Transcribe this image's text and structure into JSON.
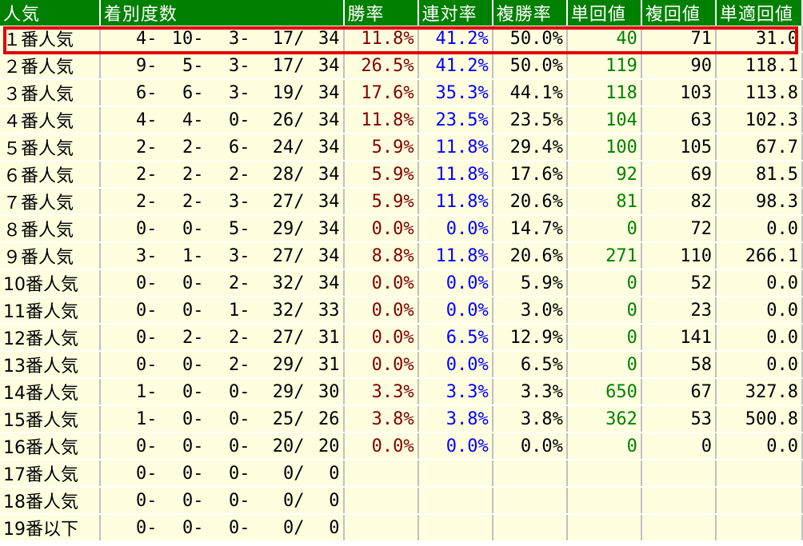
{
  "headers": [
    "人気",
    "着別度数",
    "勝率",
    "連対率",
    "複勝率",
    "単回値",
    "複回値",
    "単適回値"
  ],
  "colors": {
    "header_bg": "#008000",
    "row_bg": "#ffffe0",
    "win": "#800000",
    "ren": "#0000ff",
    "tan": "#008000",
    "highlight": "#e00000"
  },
  "rows": [
    {
      "label": "１番人気",
      "record": [
        "4-",
        "10-",
        "3-",
        "17/",
        "34"
      ],
      "win": "11.8%",
      "ren": "41.2%",
      "fuku": "50.0%",
      "tan": "40",
      "fukuv": "71",
      "tanv": "31.0"
    },
    {
      "label": "２番人気",
      "record": [
        "9-",
        "5-",
        "3-",
        "17/",
        "34"
      ],
      "win": "26.5%",
      "ren": "41.2%",
      "fuku": "50.0%",
      "tan": "119",
      "fukuv": "90",
      "tanv": "118.1"
    },
    {
      "label": "３番人気",
      "record": [
        "6-",
        "6-",
        "3-",
        "19/",
        "34"
      ],
      "win": "17.6%",
      "ren": "35.3%",
      "fuku": "44.1%",
      "tan": "118",
      "fukuv": "103",
      "tanv": "113.8"
    },
    {
      "label": "４番人気",
      "record": [
        "4-",
        "4-",
        "0-",
        "26/",
        "34"
      ],
      "win": "11.8%",
      "ren": "23.5%",
      "fuku": "23.5%",
      "tan": "104",
      "fukuv": "63",
      "tanv": "102.3"
    },
    {
      "label": "５番人気",
      "record": [
        "2-",
        "2-",
        "6-",
        "24/",
        "34"
      ],
      "win": "5.9%",
      "ren": "11.8%",
      "fuku": "29.4%",
      "tan": "100",
      "fukuv": "105",
      "tanv": "67.7"
    },
    {
      "label": "６番人気",
      "record": [
        "2-",
        "2-",
        "2-",
        "28/",
        "34"
      ],
      "win": "5.9%",
      "ren": "11.8%",
      "fuku": "17.6%",
      "tan": "92",
      "fukuv": "69",
      "tanv": "81.5"
    },
    {
      "label": "７番人気",
      "record": [
        "2-",
        "2-",
        "3-",
        "27/",
        "34"
      ],
      "win": "5.9%",
      "ren": "11.8%",
      "fuku": "20.6%",
      "tan": "81",
      "fukuv": "82",
      "tanv": "98.3"
    },
    {
      "label": "８番人気",
      "record": [
        "0-",
        "0-",
        "5-",
        "29/",
        "34"
      ],
      "win": "0.0%",
      "ren": "0.0%",
      "fuku": "14.7%",
      "tan": "0",
      "fukuv": "72",
      "tanv": "0.0"
    },
    {
      "label": "９番人気",
      "record": [
        "3-",
        "1-",
        "3-",
        "27/",
        "34"
      ],
      "win": "8.8%",
      "ren": "11.8%",
      "fuku": "20.6%",
      "tan": "271",
      "fukuv": "110",
      "tanv": "266.1"
    },
    {
      "label": "10番人気",
      "record": [
        "0-",
        "0-",
        "2-",
        "32/",
        "34"
      ],
      "win": "0.0%",
      "ren": "0.0%",
      "fuku": "5.9%",
      "tan": "0",
      "fukuv": "52",
      "tanv": "0.0"
    },
    {
      "label": "11番人気",
      "record": [
        "0-",
        "0-",
        "1-",
        "32/",
        "33"
      ],
      "win": "0.0%",
      "ren": "0.0%",
      "fuku": "3.0%",
      "tan": "0",
      "fukuv": "23",
      "tanv": "0.0"
    },
    {
      "label": "12番人気",
      "record": [
        "0-",
        "2-",
        "2-",
        "27/",
        "31"
      ],
      "win": "0.0%",
      "ren": "6.5%",
      "fuku": "12.9%",
      "tan": "0",
      "fukuv": "141",
      "tanv": "0.0"
    },
    {
      "label": "13番人気",
      "record": [
        "0-",
        "0-",
        "2-",
        "29/",
        "31"
      ],
      "win": "0.0%",
      "ren": "0.0%",
      "fuku": "6.5%",
      "tan": "0",
      "fukuv": "58",
      "tanv": "0.0"
    },
    {
      "label": "14番人気",
      "record": [
        "1-",
        "0-",
        "0-",
        "29/",
        "30"
      ],
      "win": "3.3%",
      "ren": "3.3%",
      "fuku": "3.3%",
      "tan": "650",
      "fukuv": "67",
      "tanv": "327.8"
    },
    {
      "label": "15番人気",
      "record": [
        "1-",
        "0-",
        "0-",
        "25/",
        "26"
      ],
      "win": "3.8%",
      "ren": "3.8%",
      "fuku": "3.8%",
      "tan": "362",
      "fukuv": "53",
      "tanv": "500.8"
    },
    {
      "label": "16番人気",
      "record": [
        "0-",
        "0-",
        "0-",
        "20/",
        "20"
      ],
      "win": "0.0%",
      "ren": "0.0%",
      "fuku": "0.0%",
      "tan": "0",
      "fukuv": "0",
      "tanv": "0.0"
    },
    {
      "label": "17番人気",
      "record": [
        "0-",
        "0-",
        "0-",
        "0/",
        "0"
      ],
      "win": "",
      "ren": "",
      "fuku": "",
      "tan": "",
      "fukuv": "",
      "tanv": ""
    },
    {
      "label": "18番人気",
      "record": [
        "0-",
        "0-",
        "0-",
        "0/",
        "0"
      ],
      "win": "",
      "ren": "",
      "fuku": "",
      "tan": "",
      "fukuv": "",
      "tanv": ""
    },
    {
      "label": "19番以下",
      "record": [
        "0-",
        "0-",
        "0-",
        "0/",
        "0"
      ],
      "win": "",
      "ren": "",
      "fuku": "",
      "tan": "",
      "fukuv": "",
      "tanv": ""
    }
  ]
}
